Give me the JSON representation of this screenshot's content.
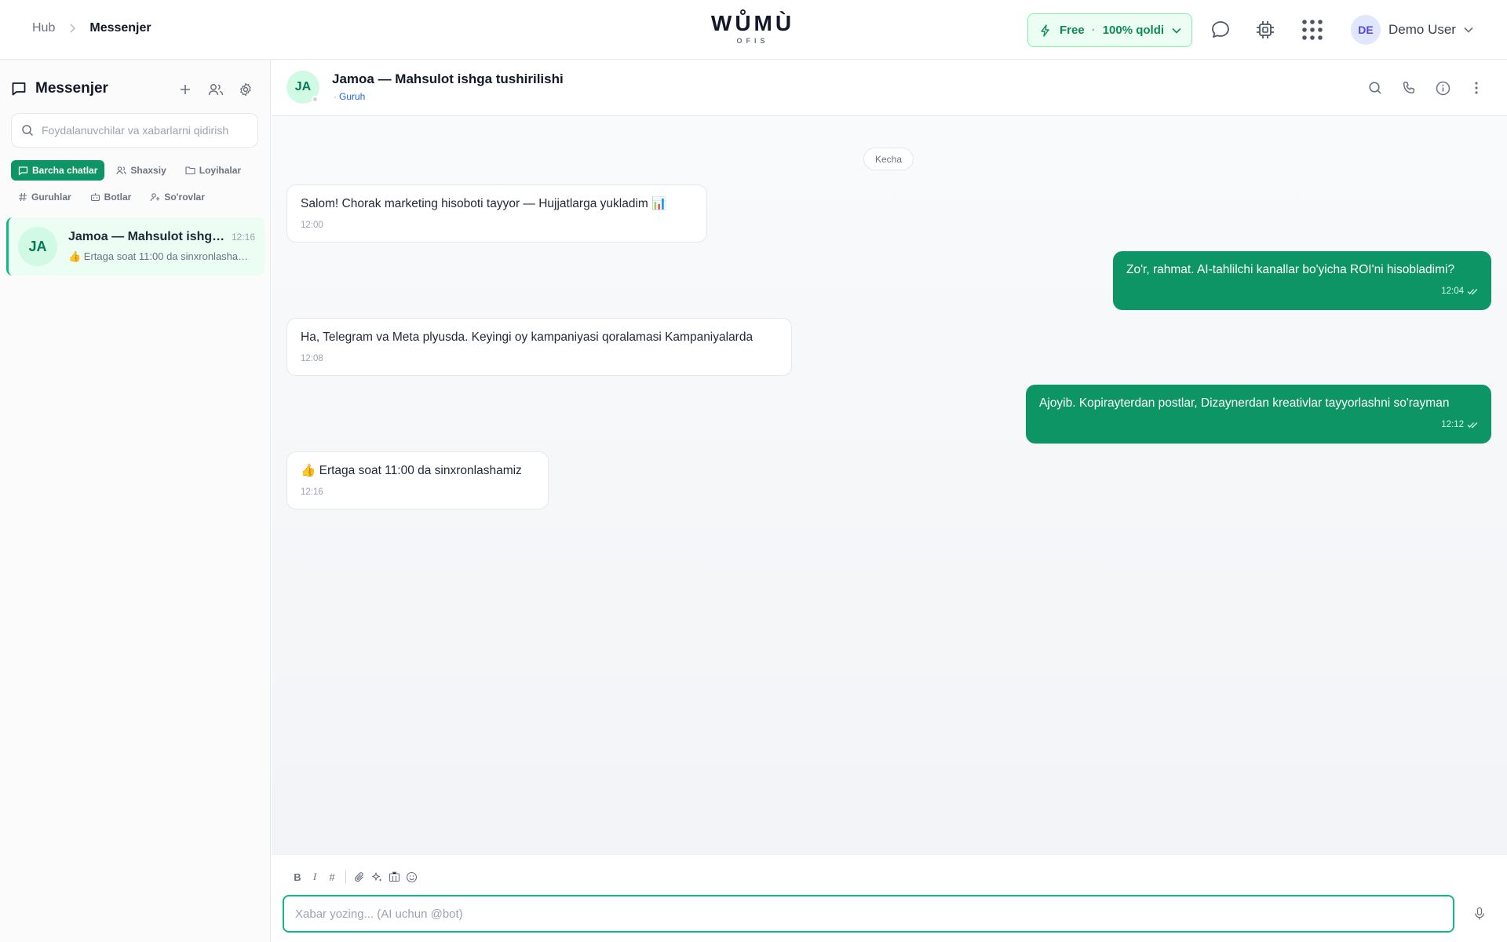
{
  "breadcrumb": {
    "root": "Hub",
    "current": "Messenjer"
  },
  "logo": {
    "main": "WŮMÙ",
    "sub": "OFIS"
  },
  "plan": {
    "name": "Free",
    "remaining": "100% qoldi"
  },
  "user": {
    "initials": "DE",
    "name": "Demo User"
  },
  "sidebar": {
    "title": "Messenjer",
    "search_placeholder": "Foydalanuvchilar va xabarlarni qidirish",
    "filters": [
      {
        "label": "Barcha chatlar",
        "icon": "chat-icon",
        "active": true
      },
      {
        "label": "Shaxsiy",
        "icon": "users-icon"
      },
      {
        "label": "Loyihalar",
        "icon": "folder-icon"
      },
      {
        "label": "Guruhlar",
        "icon": "hash-icon"
      },
      {
        "label": "Botlar",
        "icon": "bot-icon"
      },
      {
        "label": "So'rovlar",
        "icon": "user-plus-icon"
      }
    ],
    "chats": [
      {
        "initials": "JA",
        "title": "Jamoa — Mahsulot ishga tushirilishi",
        "time": "12:16",
        "preview": "👍 Ertaga soat 11:00 da sinxronlashamiz"
      }
    ]
  },
  "chat": {
    "initials": "JA",
    "title": "Jamoa — Mahsulot ishga tushirilishi",
    "subtitle": "Guruh",
    "day_separator": "Kecha",
    "messages": [
      {
        "dir": "in",
        "text": "Salom! Chorak marketing hisoboti tayyor — Hujjatlarga yukladim 📊",
        "time": "12:00"
      },
      {
        "dir": "out",
        "text": "Zo'r, rahmat. AI-tahlilchi kanallar bo'yicha ROI'ni hisobladimi?",
        "time": "12:04"
      },
      {
        "dir": "in",
        "text": "Ha, Telegram va Meta plyusda. Keyingi oy kampaniyasi qoralamasi Kampaniyalarda",
        "time": "12:08"
      },
      {
        "dir": "out",
        "text": "Ajoyib. Kopirayterdan postlar, Dizaynerdan kreativlar tayyorlashni so'rayman",
        "time": "12:12"
      },
      {
        "dir": "in",
        "text": "👍 Ertaga soat 11:00 da sinxronlashamiz",
        "time": "12:16"
      }
    ]
  },
  "composer": {
    "placeholder": "Xabar yozing... (AI uchun @bot)",
    "bold": "B",
    "italic": "I",
    "hash": "#"
  },
  "colors": {
    "accent": "#0e9566",
    "accent_light": "#ecfdf3"
  }
}
